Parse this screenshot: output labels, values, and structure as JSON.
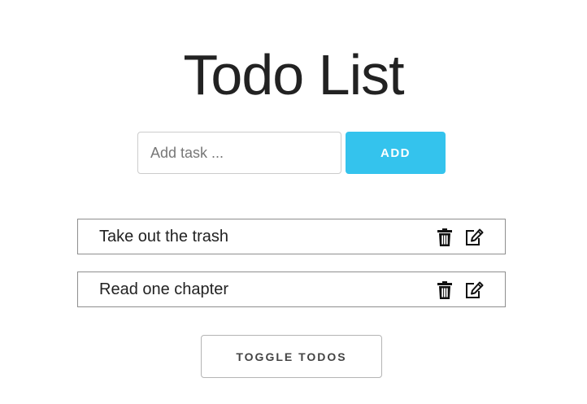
{
  "header": {
    "title": "Todo List"
  },
  "add_form": {
    "input_value": "",
    "input_placeholder": "Add task ...",
    "add_label": "ADD"
  },
  "todos": [
    {
      "text": "Take out the trash",
      "delete_icon": "trash-icon",
      "edit_icon": "edit-icon"
    },
    {
      "text": "Read one chapter",
      "delete_icon": "trash-icon",
      "edit_icon": "edit-icon"
    }
  ],
  "toggle_label": "TOGGLE TODOS",
  "colors": {
    "accent": "#34c3ed",
    "text": "#222222",
    "border": "#8e8e8e"
  }
}
